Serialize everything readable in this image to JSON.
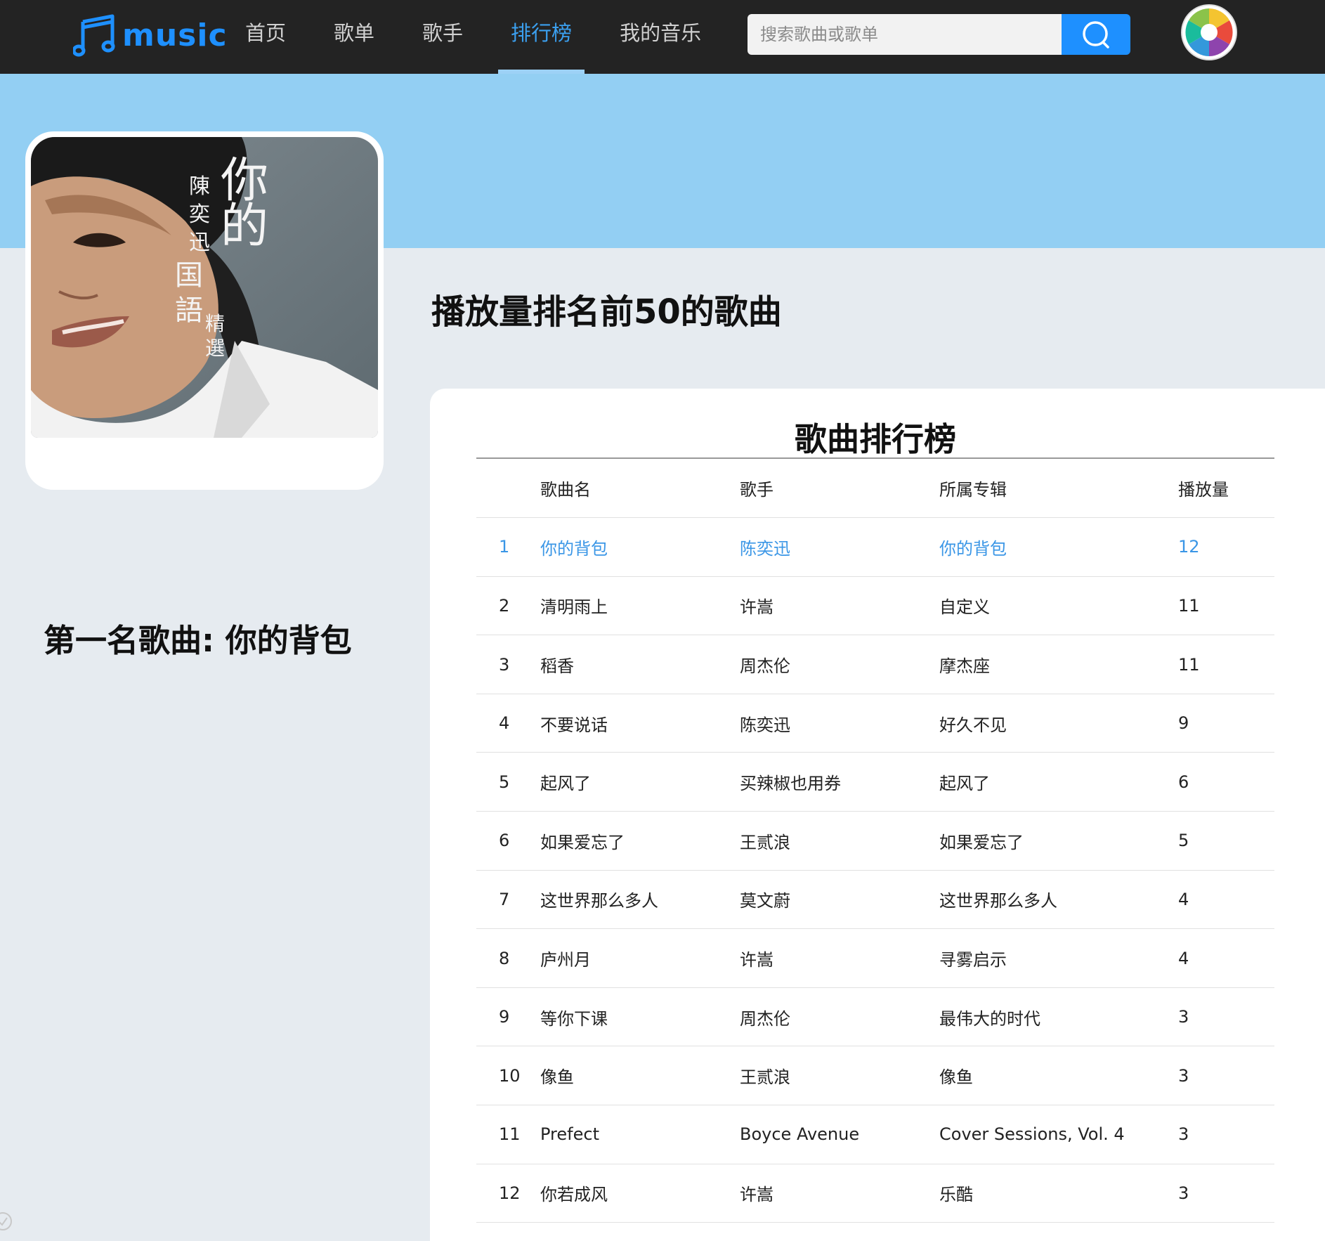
{
  "header": {
    "logo_text": "music",
    "nav": [
      "首页",
      "歌单",
      "歌手",
      "排行榜",
      "我的音乐"
    ],
    "active_nav": "排行榜",
    "search_placeholder": "搜索歌曲或歌单"
  },
  "sidebar": {
    "cover_art_text": "你的 陳奕迅国語精選",
    "first_song_label": "第一名歌曲: 你的背包"
  },
  "main": {
    "heading": "播放量排名前50的歌曲",
    "rank_title": "歌曲排行榜",
    "columns": [
      "",
      "歌曲名",
      "歌手",
      "所属专辑",
      "播放量"
    ],
    "rows": [
      {
        "rank": "1",
        "song": "你的背包",
        "artist": "陈奕迅",
        "album": "你的背包",
        "plays": "12"
      },
      {
        "rank": "2",
        "song": "清明雨上",
        "artist": "许嵩",
        "album": "自定义",
        "plays": "11"
      },
      {
        "rank": "3",
        "song": "稻香",
        "artist": "周杰伦",
        "album": "摩杰座",
        "plays": "11"
      },
      {
        "rank": "4",
        "song": "不要说话",
        "artist": "陈奕迅",
        "album": "好久不见",
        "plays": "9"
      },
      {
        "rank": "5",
        "song": "起风了",
        "artist": "买辣椒也用券",
        "album": "起风了",
        "plays": "6"
      },
      {
        "rank": "6",
        "song": "如果爱忘了",
        "artist": "王贰浪",
        "album": "如果爱忘了",
        "plays": "5"
      },
      {
        "rank": "7",
        "song": "这世界那么多人",
        "artist": "莫文蔚",
        "album": "这世界那么多人",
        "plays": "4"
      },
      {
        "rank": "8",
        "song": "庐州月",
        "artist": "许嵩",
        "album": "寻雾启示",
        "plays": "4"
      },
      {
        "rank": "9",
        "song": "等你下课",
        "artist": "周杰伦",
        "album": "最伟大的时代",
        "plays": "3"
      },
      {
        "rank": "10",
        "song": "像鱼",
        "artist": "王贰浪",
        "album": "像鱼",
        "plays": "3"
      },
      {
        "rank": "11",
        "song": "Prefect",
        "artist": "Boyce Avenue",
        "album": "Cover Sessions, Vol. 4",
        "plays": "3"
      },
      {
        "rank": "12",
        "song": "你若成风",
        "artist": "许嵩",
        "album": "乐酷",
        "plays": "3"
      }
    ]
  },
  "colors": {
    "accent": "#1e90ff",
    "highlight_row": "#3a96e6",
    "banner": "#93cff3",
    "page_bg": "#e6ebf0",
    "topbar": "#232323"
  },
  "icons": {
    "logo": "music-note-icon",
    "search": "search-icon",
    "avatar": "aperture-avatar-icon"
  }
}
